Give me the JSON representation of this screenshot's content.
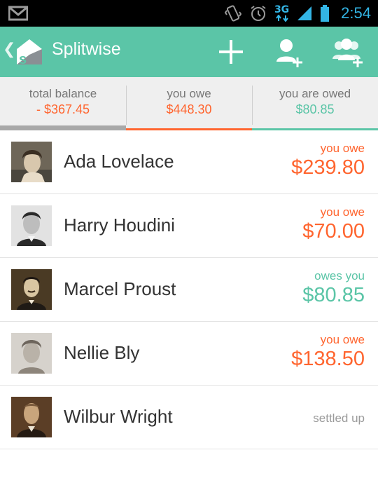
{
  "colors": {
    "brand": "#5bc5a7",
    "owe": "#ff652f",
    "owed": "#5bc5a7",
    "statusIcons": "#33b5e5"
  },
  "status_bar": {
    "network": "3G",
    "time": "2:54",
    "icons": [
      "gmail-icon",
      "vibrate-icon",
      "alarm-icon",
      "signal-icon",
      "battery-icon"
    ]
  },
  "action_bar": {
    "title": "Splitwise",
    "icons": [
      "back-chevron-icon",
      "splitwise-logo-icon",
      "add-icon",
      "add-friend-icon",
      "add-group-icon"
    ]
  },
  "tabs": [
    {
      "label": "total balance",
      "amount": "- $367.45"
    },
    {
      "label": "you owe",
      "amount": "$448.30"
    },
    {
      "label": "you are owed",
      "amount": "$80.85"
    }
  ],
  "friends": [
    {
      "name": "Ada Lovelace",
      "status": "you owe",
      "amount": "$239.80"
    },
    {
      "name": "Harry Houdini",
      "status": "you owe",
      "amount": "$70.00"
    },
    {
      "name": "Marcel Proust",
      "status": "owes you",
      "amount": "$80.85"
    },
    {
      "name": "Nellie Bly",
      "status": "you owe",
      "amount": "$138.50"
    },
    {
      "name": "Wilbur Wright",
      "status": "settled up",
      "amount": ""
    }
  ]
}
